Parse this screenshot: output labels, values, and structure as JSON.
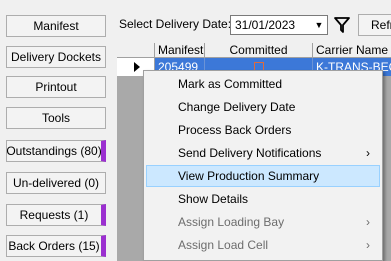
{
  "sidebar": {
    "buttons": [
      {
        "label": "Manifest"
      },
      {
        "label": "Delivery Dockets"
      },
      {
        "label": "Printout"
      },
      {
        "label": "Tools"
      },
      {
        "label": "Outstandings (80)"
      },
      {
        "label": "Un-delivered (0)"
      },
      {
        "label": "Requests (1)"
      },
      {
        "label": "Back Orders (15)"
      }
    ]
  },
  "toolbar": {
    "date_label": "Select Delivery Date:",
    "date_value": "31/01/2023",
    "refresh_label": "Refr"
  },
  "grid": {
    "columns": [
      "Manifest",
      "Committed",
      "Carrier Name"
    ],
    "rows": [
      {
        "manifest": "205499",
        "carrier": "K-TRANS-BEC"
      }
    ]
  },
  "context_menu": {
    "items": [
      {
        "label": "Mark as Committed"
      },
      {
        "label": "Change Delivery Date"
      },
      {
        "label": "Process Back Orders"
      },
      {
        "label": "Send Delivery Notifications"
      },
      {
        "label": "View Production Summary"
      },
      {
        "label": "Show Details"
      },
      {
        "label": "Assign Loading Bay"
      },
      {
        "label": "Assign Load Cell"
      }
    ]
  },
  "colors": {
    "flag_accent": "#9b2fd0",
    "selection": "#3c78d8",
    "menu_highlight": "#cce8ff"
  },
  "icons": {
    "filter": "funnel-icon",
    "submenu": "chevron-right-icon",
    "row_pointer": "row-pointer-icon"
  }
}
